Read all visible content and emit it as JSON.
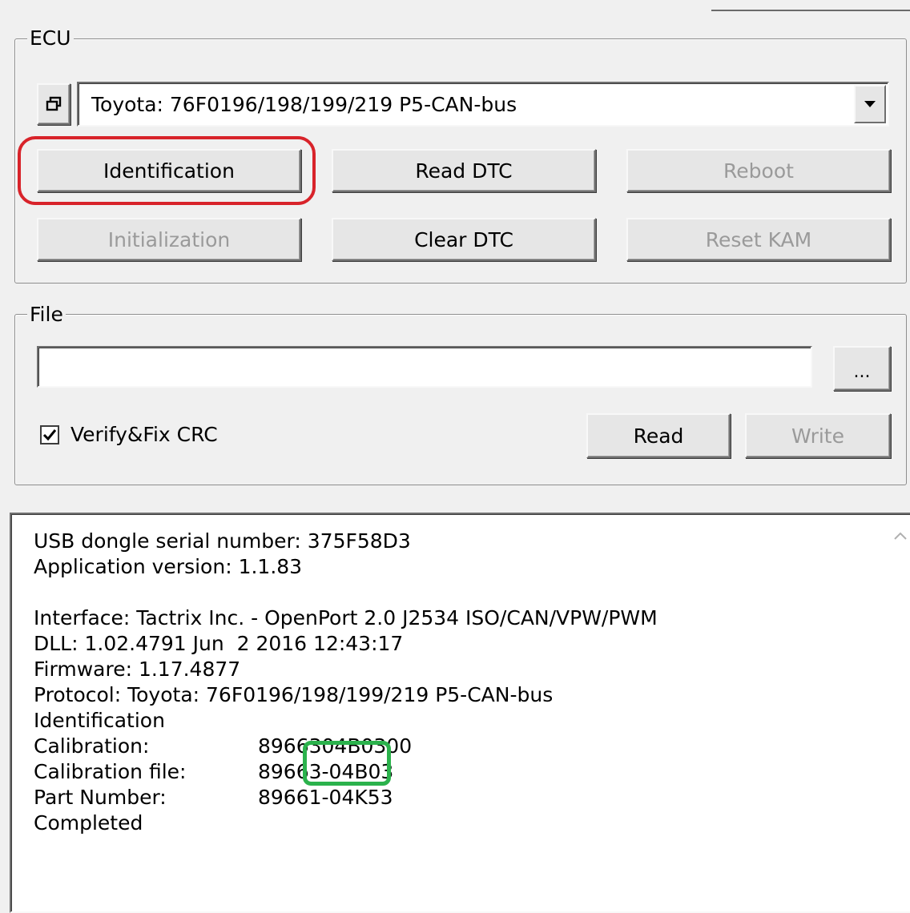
{
  "ecu_group": {
    "label": "ECU",
    "protocol_select": {
      "value": "Toyota: 76F0196/198/199/219 P5-CAN-bus"
    },
    "buttons": {
      "identification": "Identification",
      "read_dtc": "Read DTC",
      "reboot": "Reboot",
      "initialization": "Initialization",
      "clear_dtc": "Clear DTC",
      "reset_kam": "Reset KAM"
    }
  },
  "file_group": {
    "label": "File",
    "path_value": "",
    "browse_label": "...",
    "verify_crc": {
      "label": "Verify&Fix CRC",
      "checked": true
    },
    "read_label": "Read",
    "write_label": "Write"
  },
  "log": {
    "lines": [
      "USB dongle serial number: 375F58D3",
      "Application version: 1.1.83",
      "",
      "Interface: Tactrix Inc. - OpenPort 2.0 J2534 ISO/CAN/VPW/PWM",
      "DLL: 1.02.4791 Jun  2 2016 12:43:17",
      "Firmware: 1.17.4877",
      "Protocol: Toyota: 76F0196/198/199/219 P5-CAN-bus",
      "Identification"
    ],
    "fields": [
      {
        "key": "Calibration:",
        "value": "8966304B0300"
      },
      {
        "key": "Calibration file:",
        "value": "89663-04B03"
      },
      {
        "key": "Part Number:",
        "value": "89661-04K53"
      }
    ],
    "status": "Completed"
  },
  "colors": {
    "highlight_red": "#d8232a",
    "highlight_green": "#2bb24c",
    "disabled_text": "#9a9a9a",
    "window_bg": "#f0f0f0"
  }
}
